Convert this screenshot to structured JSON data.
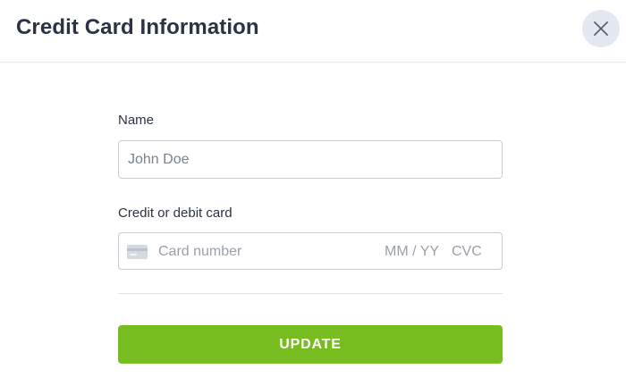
{
  "dialog": {
    "title": "Credit Card Information",
    "close_icon": "close-icon"
  },
  "form": {
    "name": {
      "label": "Name",
      "placeholder": "John Doe",
      "value": ""
    },
    "card": {
      "label": "Credit or debit card",
      "icon": "credit-card-icon",
      "number_placeholder": "Card number",
      "expiry_placeholder": "MM / YY",
      "cvc_placeholder": "CVC"
    },
    "submit_label": "UPDATE"
  },
  "colors": {
    "accent": "#78bd1f",
    "title_text": "#2b3245",
    "close_button_bg": "#e3e8f0",
    "input_border": "#c7cbd3",
    "placeholder_text": "#9aa0aa"
  }
}
